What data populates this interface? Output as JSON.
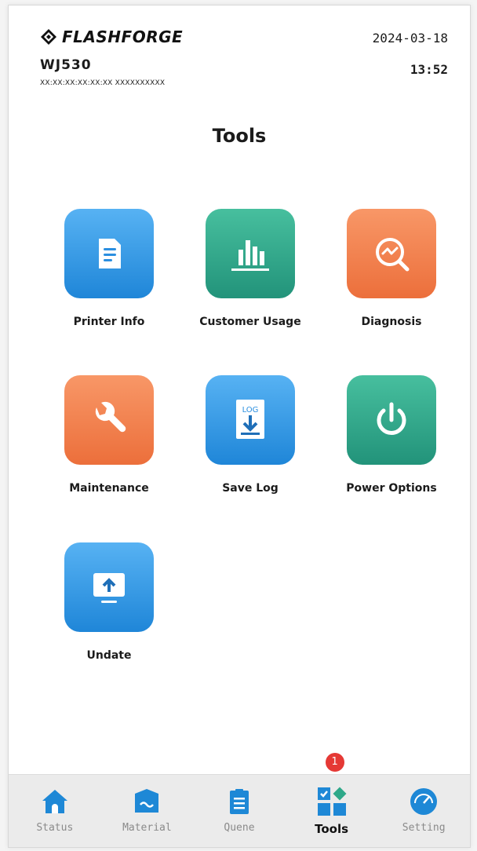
{
  "header": {
    "brand": "FLASHFORGE",
    "model": "WJ530",
    "serial": "XX:XX:XX:XX:XX:XX   XXXXXXXXXX",
    "date": "2024-03-18",
    "time": "13:52"
  },
  "page": {
    "title": "Tools"
  },
  "tools": [
    {
      "label": "Printer Info",
      "icon": "document-icon",
      "color": "#3a9ee8"
    },
    {
      "label": "Customer Usage",
      "icon": "bar-chart-icon",
      "color": "#2ea889"
    },
    {
      "label": "Diagnosis",
      "icon": "magnifier-chart-icon",
      "color": "#f27e4b"
    },
    {
      "label": "Maintenance",
      "icon": "wrench-icon",
      "color": "#f27e4b"
    },
    {
      "label": "Save Log",
      "icon": "save-log-icon",
      "icon_text": "LOG",
      "color": "#3a9ee8"
    },
    {
      "label": "Power Options",
      "icon": "power-icon",
      "color": "#2ea889"
    },
    {
      "label": "Undate",
      "icon": "monitor-upload-icon",
      "color": "#3a9ee8"
    }
  ],
  "nav": {
    "items": [
      {
        "label": "Status",
        "icon": "home-icon"
      },
      {
        "label": "Material",
        "icon": "material-icon"
      },
      {
        "label": "Quene",
        "icon": "clipboard-icon"
      },
      {
        "label": "Tools",
        "icon": "tools-icon",
        "active": true,
        "badge": "1"
      },
      {
        "label": "Setting",
        "icon": "gauge-icon"
      }
    ]
  },
  "colors": {
    "accent_blue": "#2b8fe0",
    "accent_green": "#2ea889",
    "accent_orange": "#f27e4b",
    "badge_red": "#e53935"
  }
}
